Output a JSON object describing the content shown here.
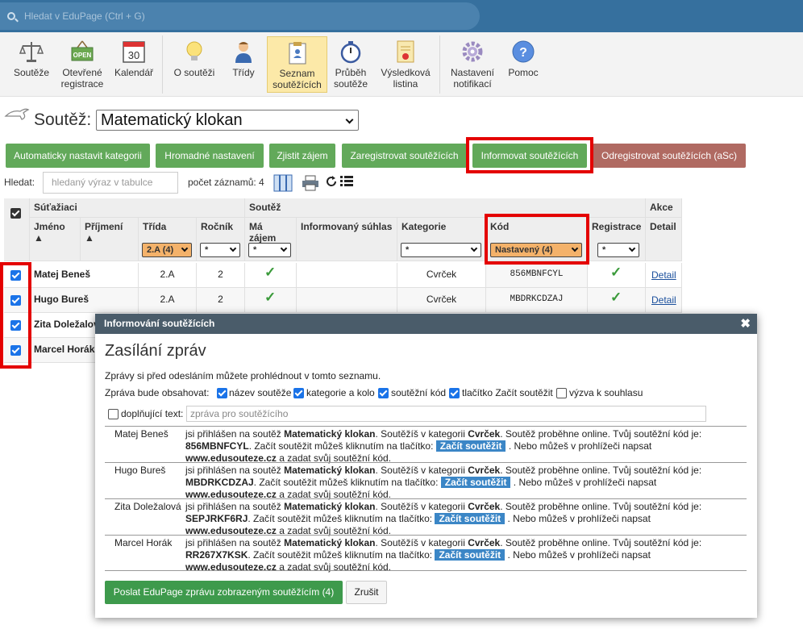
{
  "search": {
    "placeholder": "Hledat v EduPage (Ctrl + G)"
  },
  "toolbar": {
    "items": [
      {
        "label": "Soutěže",
        "icon": "scales-icon"
      },
      {
        "label": "Otevřené registrace",
        "icon": "open-sign-icon",
        "badge": "OPEN"
      },
      {
        "label": "Kalendář",
        "icon": "calendar-icon",
        "badge": "30"
      },
      {
        "label": "O soutěži",
        "icon": "lightbulb-icon"
      },
      {
        "label": "Třídy",
        "icon": "student-icon"
      },
      {
        "label": "Seznam soutěžících",
        "icon": "clipboard-icon"
      },
      {
        "label": "Průběh soutěže",
        "icon": "stopwatch-icon"
      },
      {
        "label": "Výsledková listina",
        "icon": "certificate-icon"
      },
      {
        "label": "Nastavení notifikací",
        "icon": "gear-icon"
      },
      {
        "label": "Pomoc",
        "icon": "help-icon",
        "badge": "?"
      }
    ]
  },
  "page": {
    "soutez_label": "Soutěž:",
    "soutez_value": "Matematický klokan"
  },
  "actions": [
    "Automaticky nastavit kategorii",
    "Hromadné nastavení",
    "Zjistit zájem",
    "Zaregistrovat soutěžících",
    "Informovat soutěžících",
    "Odregistrovat soutěžících (aSc)"
  ],
  "filter": {
    "label": "Hledat:",
    "placeholder": "hledaný výraz v tabulce",
    "count": "počet záznamů: 4"
  },
  "table": {
    "group1": "Súťažiaci",
    "group2": "Soutěž",
    "group3": "Akce",
    "cols": {
      "jmeno": "Jméno",
      "prijmeni": "Příjmení",
      "trida": "Třída",
      "rocnik": "Ročník",
      "zajem": "Má zájem",
      "suhlas": "Informovaný súhlas",
      "kategorie": "Kategorie",
      "kod": "Kód",
      "registrace": "Registrace",
      "detail": "Detail"
    },
    "filters": {
      "trida": "2.A (4)",
      "rocnik": "*",
      "zajem": "*",
      "kategorie": "*",
      "kod": "Nastavený (4)",
      "registrace": "*"
    },
    "rows": [
      {
        "name": "Matej Beneš",
        "trida": "2.A",
        "rocnik": "2",
        "check": "✓",
        "kategorie": "Cvrček",
        "kod": "856MBNFCYL",
        "detail": "Detail"
      },
      {
        "name": "Hugo Bureš",
        "trida": "2.A",
        "rocnik": "2",
        "check": "✓",
        "kategorie": "Cvrček",
        "kod": "MBDRKCDZAJ",
        "detail": "Detail"
      },
      {
        "name": "Zita Doležalová"
      },
      {
        "name": "Marcel Horák"
      }
    ]
  },
  "modal": {
    "header": "Informování soutěžících",
    "close": "✖",
    "title": "Zasílání zpráv",
    "info": "Zprávy si před odesláním můžete prohlédnout v tomto seznamu.",
    "contains": "Zpráva bude obsahovat:",
    "options": [
      "název soutěže",
      "kategorie a kolo",
      "soutěžní kód",
      "tlačítko Začít soutěžit",
      "výzva k souhlasu"
    ],
    "extra_label": "doplňující text:",
    "extra_placeholder": "zpráva pro soutěžícího",
    "msg": {
      "p1": "jsi přihlášen na soutěž ",
      "soutez": "Matematický klokan",
      "p2": ". Soutěžíš v kategorii ",
      "kat": "Cvrček",
      "p3": ". Soutěž proběhne online. Tvůj soutěžní kód je:",
      "p4": ". Začít soutěžit můžeš kliknutím na tlačítko:",
      "btn": "Začít soutěžit",
      "p5": ". Nebo můžeš v prohlížeči napsat",
      "url": "www.edusouteze.cz",
      "p6": " a zadat svůj soutěžní kód."
    },
    "messages": [
      {
        "name": "Matej Beneš",
        "code": "856MBNFCYL"
      },
      {
        "name": "Hugo Bureš",
        "code": "MBDRKCDZAJ"
      },
      {
        "name": "Zita Doležalová",
        "code": "SEPJRKF6RJ"
      },
      {
        "name": "Marcel Horák",
        "code": "RR267X7KSK"
      }
    ],
    "send": "Poslat EduPage zprávu zobrazeným soutěžícím (4)",
    "cancel": "Zrušit"
  },
  "colors": {
    "topbar": "#36709e",
    "green": "#62a95a",
    "red_highlight": "#e40000",
    "modal_header": "#4a5c6a"
  }
}
